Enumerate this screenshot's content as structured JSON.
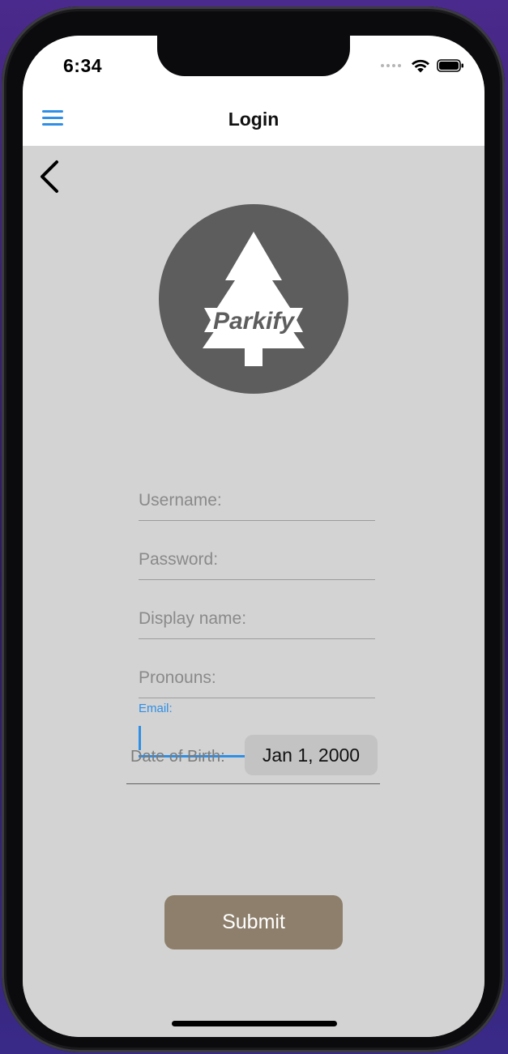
{
  "status_bar": {
    "time": "6:34",
    "icons": [
      "signal-dots-icon",
      "wifi-icon",
      "battery-icon"
    ]
  },
  "header": {
    "title": "Login",
    "menu_icon": "hamburger-menu-icon",
    "back_icon": "chevron-left-icon"
  },
  "logo": {
    "text": "Parkify",
    "icon": "pine-tree-icon",
    "circle_color": "#5d5d5d"
  },
  "form": {
    "username": {
      "placeholder": "Username:",
      "value": ""
    },
    "password": {
      "placeholder": "Password:",
      "value": ""
    },
    "display_name": {
      "placeholder": "Display name:",
      "value": ""
    },
    "pronouns": {
      "placeholder": "Pronouns:",
      "value": ""
    },
    "email": {
      "label": "Email:",
      "value": ""
    },
    "dob": {
      "label": "Date of Birth:",
      "value": "Jan 1, 2000"
    },
    "submit_label": "Submit"
  },
  "colors": {
    "accent": "#2f8fe6",
    "background": "#d3d3d3",
    "submit": "#8d7f6b"
  }
}
